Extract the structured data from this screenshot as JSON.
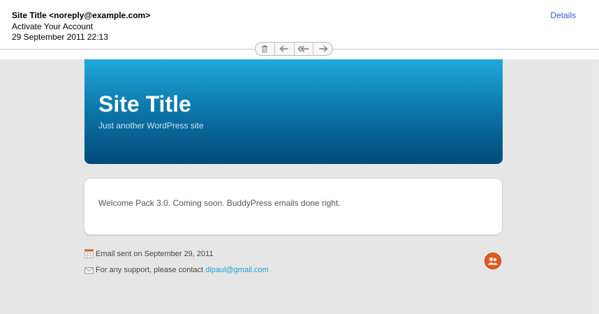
{
  "mail": {
    "from": "Site Title <noreply@example.com>",
    "subject": "Activate Your Account",
    "date": "29 September 2011 22:13",
    "details_label": "Details"
  },
  "toolbar": {
    "icons": [
      "trash-icon",
      "reply-icon",
      "reply-all-icon",
      "forward-icon"
    ]
  },
  "site": {
    "title": "Site Title",
    "tagline": "Just another WordPress site"
  },
  "content": {
    "message": "Welcome Pack 3.0. Coming soon. BuddyPress emails done right."
  },
  "footer": {
    "sent_text": "Email sent on September 29, 2011",
    "support_text": "For any support, please contact ",
    "support_email": "dipaul@gmail.com"
  },
  "colors": {
    "header_gradient_top": "#1fa9da",
    "header_gradient_bottom": "#034a78",
    "link": "#1d9fd7",
    "details_link": "#2a60c8",
    "logo": "#e8571c",
    "background": "#e6e6e6"
  }
}
